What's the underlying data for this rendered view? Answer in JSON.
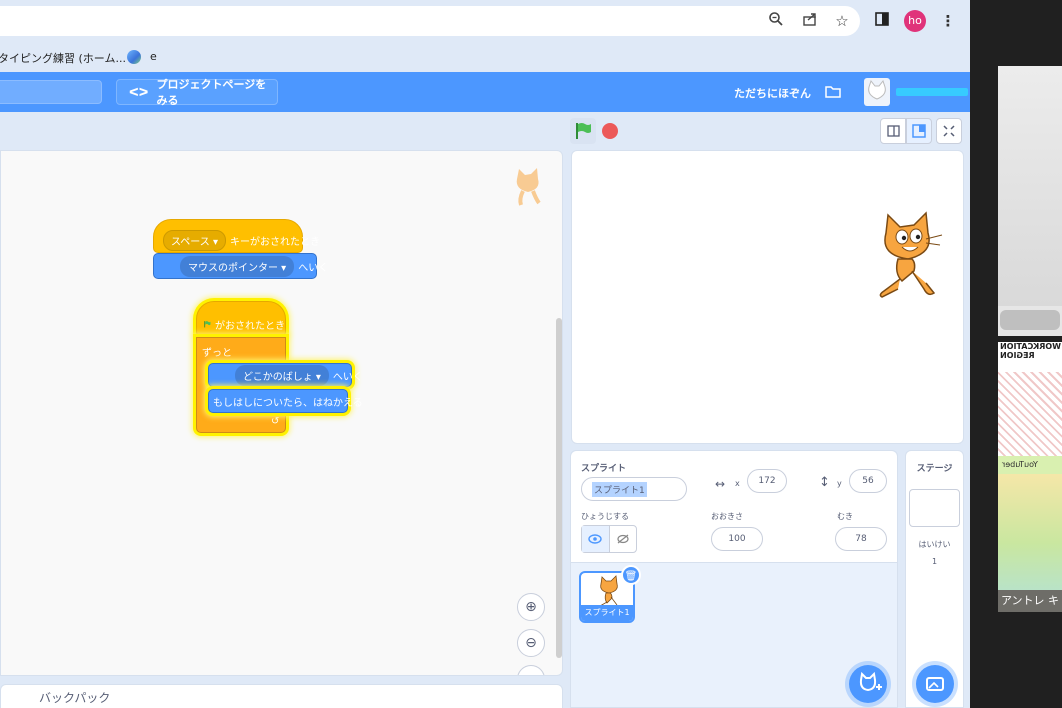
{
  "browser": {
    "bookmarks": [
      {
        "label": "タイピング練習 (ホーム..."
      },
      {
        "label": "e"
      }
    ],
    "profile_initials": "ho"
  },
  "menubar": {
    "share_label": "プロジェクトページをみる",
    "save_now_label": "ただちにほぞん"
  },
  "blocks": {
    "script1": {
      "hat_key": "スペース",
      "hat_text": "キーがおされたとき",
      "goto_target": "マウスのポインター",
      "goto_suffix": "へいく"
    },
    "script2": {
      "hat_text": "がおされたとき",
      "forever_label": "ずっと",
      "goto_target": "どこかのばしょ",
      "goto_suffix": "へいく",
      "bounce_label": "もしはしについたら、はねかえる"
    }
  },
  "backpack_label": "バックパック",
  "sprite_info": {
    "sprite_label": "スプライト",
    "name_value": "スプライト1",
    "x_label": "x",
    "x_value": "172",
    "y_label": "y",
    "y_value": "56",
    "show_label": "ひょうじする",
    "size_label": "おおきさ",
    "size_value": "100",
    "direction_label": "むき",
    "direction_value": "78"
  },
  "sprite_list": [
    {
      "name": "スプライト1"
    }
  ],
  "stage_pane": {
    "title": "ステージ",
    "backdrops_label": "はいけい",
    "backdrops_count": "1"
  },
  "video": {
    "caption": "アントレ キ",
    "banner_line1": "WORKCATION",
    "banner_line2": "REGION",
    "youtuber_text": "YouTuber"
  },
  "colors": {
    "scratch_blue": "#4c97ff",
    "events_yellow": "#ffbf00",
    "control_orange": "#ffab19",
    "stop_red": "#ec5959",
    "flag_green": "#4cbf56"
  }
}
